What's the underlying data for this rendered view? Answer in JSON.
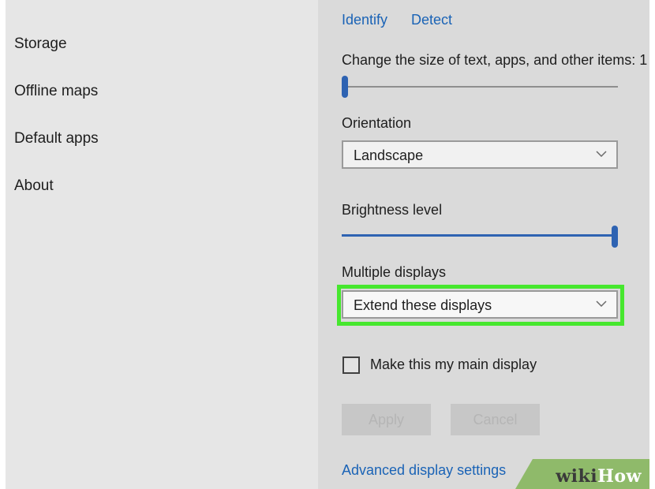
{
  "sidebar": {
    "items": [
      {
        "label": "Storage"
      },
      {
        "label": "Offline maps"
      },
      {
        "label": "Default apps"
      },
      {
        "label": "About"
      }
    ]
  },
  "display": {
    "identify_link": "Identify",
    "detect_link": "Detect",
    "scale_label": "Change the size of text, apps, and other items: 1",
    "scale_value": 0.0,
    "orientation_label": "Orientation",
    "orientation_value": "Landscape",
    "brightness_label": "Brightness level",
    "brightness_value": 1.0,
    "multiple_displays_label": "Multiple displays",
    "multiple_displays_value": "Extend these displays",
    "main_display_checkbox_label": "Make this my main display",
    "main_display_checked": false,
    "apply_button": "Apply",
    "cancel_button": "Cancel",
    "advanced_link": "Advanced display settings"
  },
  "watermark": {
    "wiki": "wiki",
    "how": "How"
  },
  "colors": {
    "accent": "#2e63b2",
    "link": "#1a63b6",
    "highlight": "#46e72e",
    "sidebar_bg": "#e6e6e6",
    "main_bg": "#dadada"
  }
}
